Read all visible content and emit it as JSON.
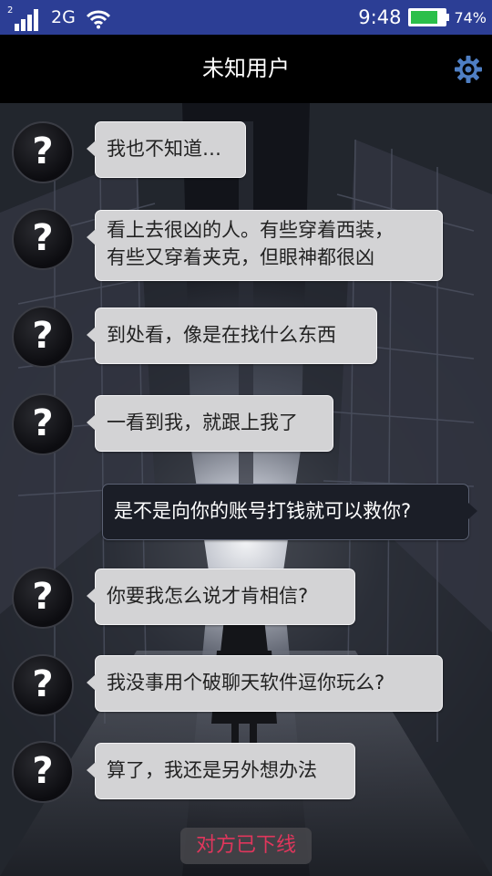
{
  "status_bar": {
    "sim_slot": "2",
    "network": "2G",
    "time": "9:48",
    "battery_level": 0.74,
    "battery_text": "74%"
  },
  "header": {
    "title": "未知用户",
    "settings_icon": "gear-icon"
  },
  "chat": {
    "avatar_glyph": "?",
    "messages": [
      {
        "from": "other",
        "text": "我也不知道…"
      },
      {
        "from": "other",
        "lines": [
          "看上去很凶的人。有些穿着西装，",
          "有些又穿着夹克，但眼神都很凶"
        ]
      },
      {
        "from": "other",
        "text": "到处看，像是在找什么东西"
      },
      {
        "from": "other",
        "text": "一看到我，就跟上我了"
      },
      {
        "from": "me",
        "text": "是不是向你的账号打钱就可以救你?"
      },
      {
        "from": "other",
        "text": "你要我怎么说才肯相信?"
      },
      {
        "from": "other",
        "text": "我没事用个破聊天软件逗你玩么?"
      },
      {
        "from": "other",
        "text": "算了，我还是另外想办法"
      }
    ],
    "status_notice": "对方已下线"
  },
  "colors": {
    "status_bar_bg": "#2c3e95",
    "header_bg": "#000000",
    "gear_color": "#4f7fc4",
    "incoming_bubble": "#d3d3d5",
    "outgoing_bubble": "#1b1e27",
    "offline_text": "#e0365c"
  }
}
